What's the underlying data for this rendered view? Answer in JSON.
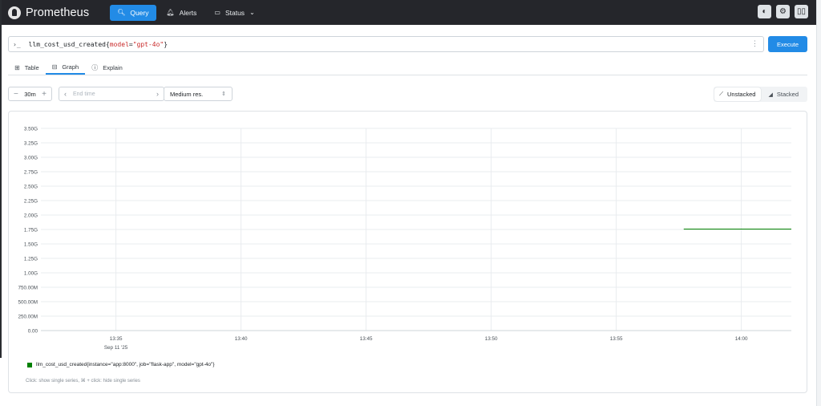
{
  "nav": {
    "brand": "Prometheus",
    "items": [
      {
        "label": "Query",
        "icon": "search-icon",
        "active": true
      },
      {
        "label": "Alerts",
        "icon": "bell-icon",
        "active": false
      },
      {
        "label": "Status",
        "icon": "server-icon",
        "active": false
      }
    ],
    "actions": [
      "theme-toggle-icon",
      "settings-icon",
      "docs-book-icon"
    ]
  },
  "query": {
    "prompt": "›_",
    "metric": "llm_cost_usd_created",
    "label_name": "model",
    "label_value": "\"gpt-4o\"",
    "execute_label": "Execute"
  },
  "tabs": [
    {
      "label": "Table",
      "icon": "table-icon"
    },
    {
      "label": "Graph",
      "icon": "graph-icon",
      "active": true
    },
    {
      "label": "Explain",
      "icon": "info-icon"
    }
  ],
  "controls": {
    "minus": "−",
    "range": "30m",
    "plus": "+",
    "end_time_placeholder": "End time",
    "resolution": "Medium res.",
    "unstacked": "Unstacked",
    "stacked": "Stacked",
    "active_mode": "unstacked"
  },
  "legend": {
    "series": "llm_cost_usd_created{instance=\"app:8000\", job=\"flask-app\", model=\"gpt-4o\"}",
    "hint": "Click: show single series, ⌘ + click: hide single series"
  },
  "chart_data": {
    "type": "line",
    "ylim": [
      0,
      3500000000
    ],
    "yticks": [
      {
        "v": 3500000000,
        "label": "3.50G"
      },
      {
        "v": 3250000000,
        "label": "3.25G"
      },
      {
        "v": 3000000000,
        "label": "3.00G"
      },
      {
        "v": 2750000000,
        "label": "2.75G"
      },
      {
        "v": 2500000000,
        "label": "2.50G"
      },
      {
        "v": 2250000000,
        "label": "2.25G"
      },
      {
        "v": 2000000000,
        "label": "2.00G"
      },
      {
        "v": 1750000000,
        "label": "1.75G"
      },
      {
        "v": 1500000000,
        "label": "1.50G"
      },
      {
        "v": 1250000000,
        "label": "1.25G"
      },
      {
        "v": 1000000000,
        "label": "1.00G"
      },
      {
        "v": 750000000,
        "label": "750.00M"
      },
      {
        "v": 500000000,
        "label": "500.00M"
      },
      {
        "v": 250000000,
        "label": "250.00M"
      },
      {
        "v": 0,
        "label": "0.00"
      }
    ],
    "xlim": [
      "13:32",
      "14:02"
    ],
    "xticks": [
      {
        "t": "13:35",
        "label": "13:35",
        "sub": "Sep 11 '25"
      },
      {
        "t": "13:40",
        "label": "13:40"
      },
      {
        "t": "13:45",
        "label": "13:45"
      },
      {
        "t": "13:50",
        "label": "13:50"
      },
      {
        "t": "13:55",
        "label": "13:55"
      },
      {
        "t": "14:00",
        "label": "14:00"
      }
    ],
    "series": [
      {
        "name": "llm_cost_usd_created{instance=\"app:8000\", job=\"flask-app\", model=\"gpt-4o\"}",
        "color": "#008000",
        "points": [
          [
            "13:57.7",
            1757600000
          ],
          [
            "14:02",
            1757600000
          ]
        ]
      }
    ],
    "grid": true
  }
}
